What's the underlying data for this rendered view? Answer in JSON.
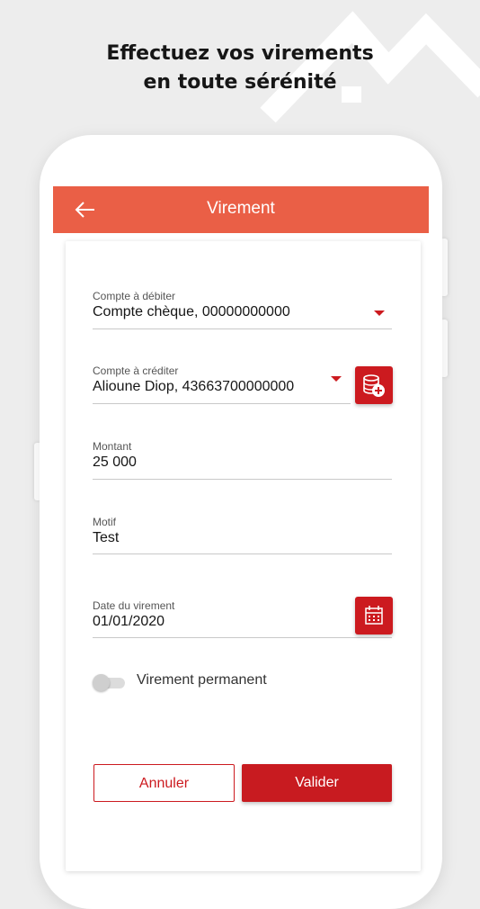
{
  "headline": {
    "line1": "Effectuez vos virements",
    "line2": "en toute sérénité"
  },
  "app_bar": {
    "title": "Virement",
    "back_icon": "arrow-left-icon"
  },
  "form": {
    "debit_account": {
      "label": "Compte à débiter",
      "value": "Compte chèque, 00000000000"
    },
    "credit_account": {
      "label": "Compte à créditer",
      "value": "Alioune Diop, 43663700000000",
      "add_icon": "add-beneficiary-icon"
    },
    "amount": {
      "label": "Montant",
      "value": "25 000"
    },
    "reason": {
      "label": "Motif",
      "value": "Test"
    },
    "transfer_date": {
      "label": "Date du virement",
      "value": "01/01/2020",
      "calendar_icon": "calendar-icon"
    },
    "permanent": {
      "label": "Virement permanent",
      "enabled": false
    }
  },
  "actions": {
    "cancel_label": "Annuler",
    "submit_label": "Valider"
  },
  "colors": {
    "header": "#ea5f46",
    "accent": "#cc1a1f",
    "background": "#ededed"
  }
}
